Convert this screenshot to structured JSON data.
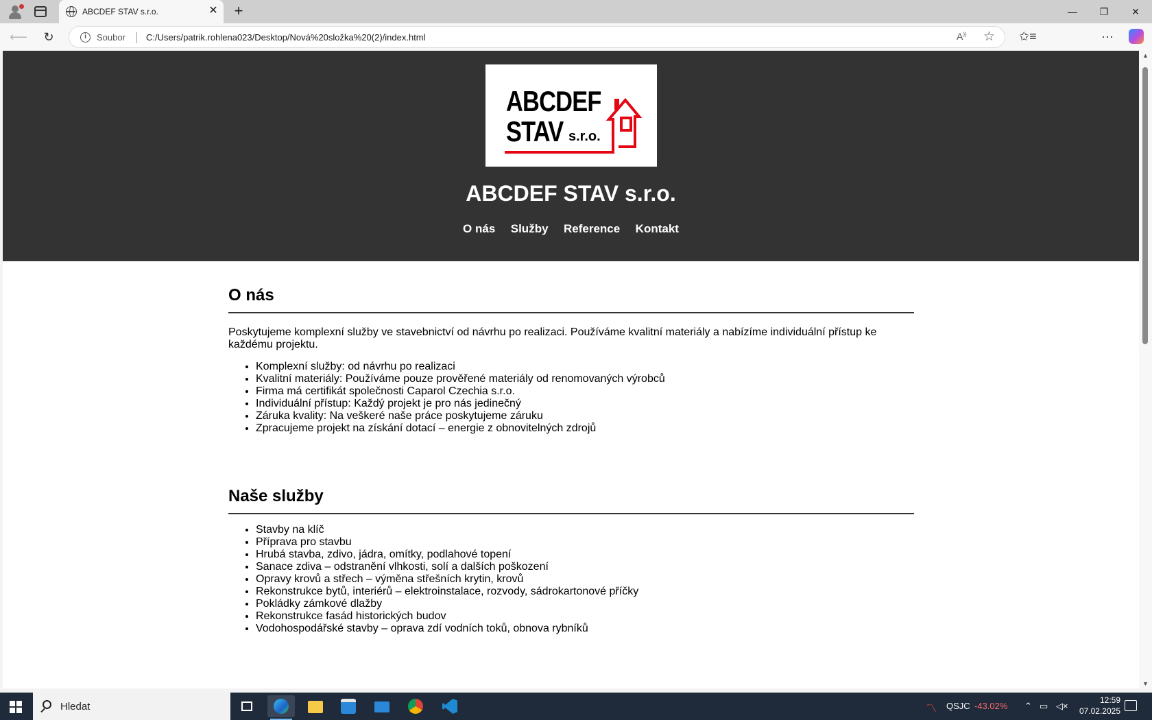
{
  "browser": {
    "tab_title": "ABCDEF STAV s.r.o.",
    "tab_close": "✕",
    "new_tab": "+",
    "window_controls": {
      "minimize": "—",
      "maximize": "❐",
      "close": "✕"
    },
    "address": {
      "scheme_label": "Soubor",
      "url": "C:/Users/patrik.rohlena023/Desktop/Nová%20složka%20(2)/index.html"
    }
  },
  "site": {
    "logo": {
      "line1": "ABCDEF",
      "line2": "STAV",
      "suffix": "s.r.o.",
      "accent_color": "#e30613"
    },
    "title": "ABCDEF STAV s.r.o.",
    "nav": [
      "O nás",
      "Služby",
      "Reference",
      "Kontakt"
    ],
    "header_bg": "#333333"
  },
  "about": {
    "heading": "O nás",
    "intro": "Poskytujeme komplexní služby ve stavebnictví od návrhu po realizaci. Používáme kvalitní materiály a nabízíme individuální přístup ke každému projektu.",
    "items": [
      "Komplexní služby: od návrhu po realizaci",
      "Kvalitní materiály: Používáme pouze prověřené materiály od renomovaných výrobců",
      "Firma má certifikát společnosti Caparol Czechia s.r.o.",
      "Individuální přístup: Každý projekt je pro nás jedinečný",
      "Záruka kvality: Na veškeré naše práce poskytujeme záruku",
      "Zpracujeme projekt na získání dotací – energie z obnovitelných zdrojů"
    ]
  },
  "services": {
    "heading": "Naše služby",
    "items": [
      "Stavby na klíč",
      "Příprava pro stavbu",
      "Hrubá stavba, zdivo, jádra, omítky, podlahové topení",
      "Sanace zdiva – odstranění vlhkosti, solí a dalších poškození",
      "Opravy krovů a střech – výměna střešních krytin, krovů",
      "Rekonstrukce bytů, interiérů – elektroinstalace, rozvody, sádrokartonové příčky",
      "Pokládky zámkové dlažby",
      "Rekonstrukce fasád historických budov",
      "Vodohospodářské stavby – oprava zdí vodních toků, obnova rybníků"
    ]
  },
  "taskbar": {
    "search_placeholder": "Hledat",
    "stock_symbol": "QSJC",
    "stock_change": "-43.02%",
    "stock_color": "#ff6b6b",
    "time": "12:59",
    "date": "07.02.2025"
  }
}
